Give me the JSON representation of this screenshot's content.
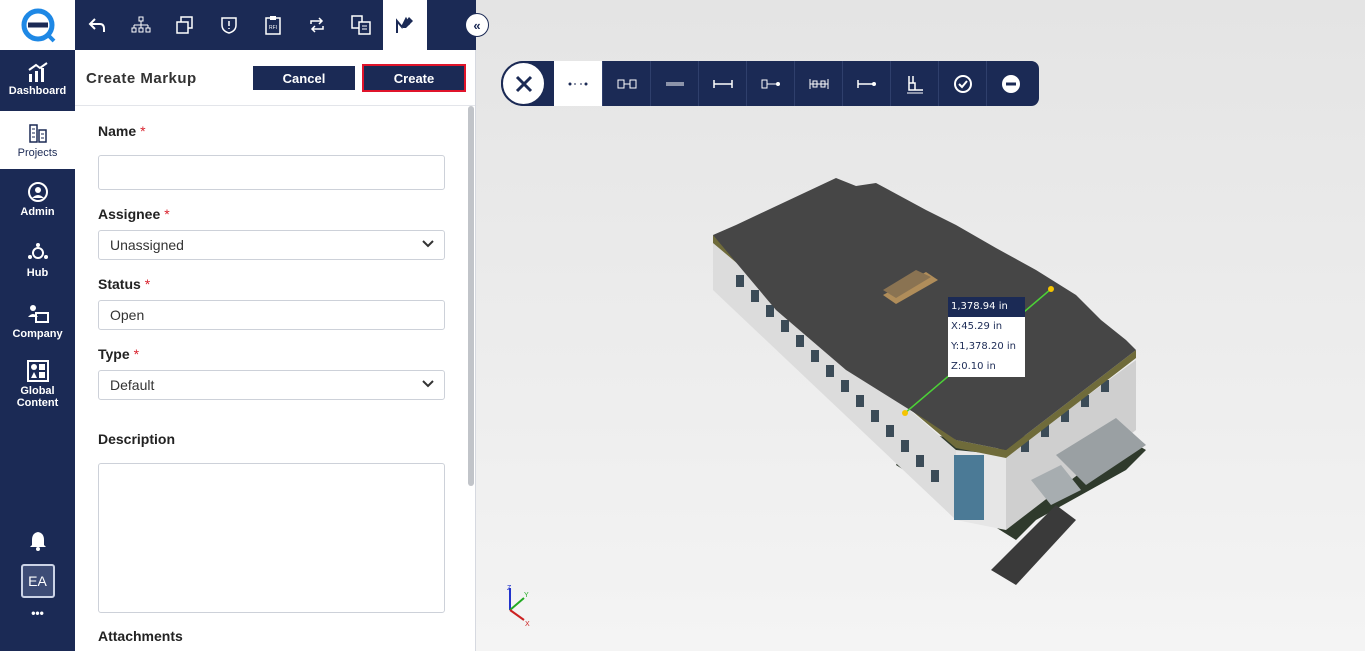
{
  "nav": {
    "items": [
      {
        "label": "Dashboard",
        "active": false
      },
      {
        "label": "Projects",
        "active": true
      },
      {
        "label": "Admin",
        "active": false
      },
      {
        "label": "Hub",
        "active": false
      },
      {
        "label": "Company",
        "active": false
      },
      {
        "label": "Global Content",
        "active": false
      }
    ],
    "avatar": "EA",
    "more": "•••"
  },
  "tabs": [
    "back-icon",
    "hierarchy-icon",
    "copy-icon",
    "issue-icon",
    "rfi-icon",
    "sync-icon",
    "compare-icon",
    "markup-icon"
  ],
  "panel": {
    "title": "Create Markup",
    "cancel_label": "Cancel",
    "create_label": "Create",
    "fields": {
      "name_label": "Name",
      "name_value": "",
      "assignee_label": "Assignee",
      "assignee_value": "Unassigned",
      "status_label": "Status",
      "status_value": "Open",
      "type_label": "Type",
      "type_value": "Default",
      "description_label": "Description",
      "description_value": "",
      "attachments_label": "Attachments"
    },
    "required_mark": "*"
  },
  "viewer": {
    "collapse_icon": "«",
    "toolbar_tools": [
      "point-to-point-icon",
      "edge-length-icon",
      "line-icon",
      "distance-icon",
      "face-distance-icon",
      "dimension-icon",
      "ray-icon",
      "angle-icon",
      "confirm-icon",
      "remove-icon"
    ],
    "measurement": {
      "total": "1,378.94 in",
      "x": "X:45.29 in",
      "y": "Y:1,378.20 in",
      "z": "Z:0.10 in"
    },
    "axes": {
      "x": "X",
      "y": "Y",
      "z": "Z"
    }
  },
  "colors": {
    "navy": "#1b2a55",
    "required": "#d9232e",
    "highlight": "#e0142b",
    "measure_line": "#4cd137"
  }
}
